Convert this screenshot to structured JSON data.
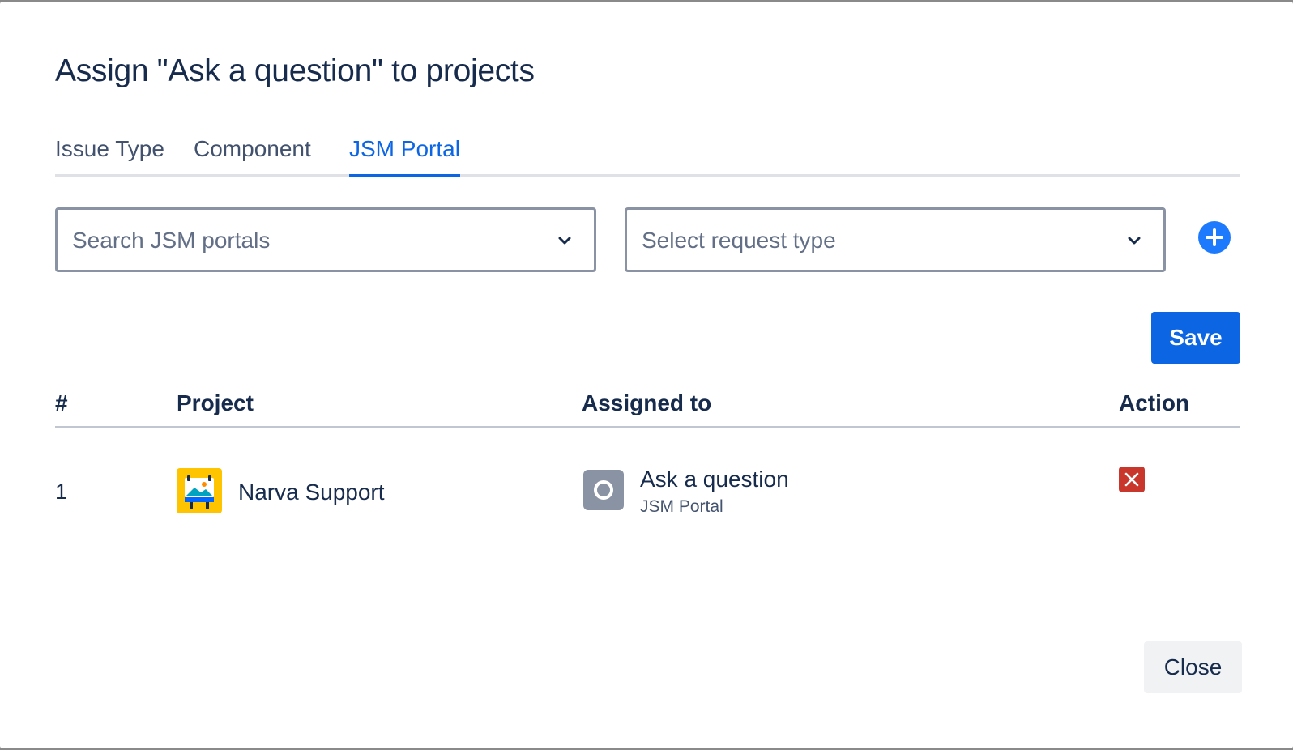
{
  "dialog": {
    "title": "Assign \"Ask a question\" to projects"
  },
  "tabs": [
    {
      "label": "Issue Type",
      "active": false
    },
    {
      "label": "Component",
      "active": false
    },
    {
      "label": "JSM Portal",
      "active": true
    }
  ],
  "filters": {
    "portal_placeholder": "Search JSM portals",
    "request_type_placeholder": "Select request type"
  },
  "actions": {
    "save_label": "Save",
    "close_label": "Close"
  },
  "table": {
    "headers": [
      "#",
      "Project",
      "Assigned to",
      "Action"
    ],
    "rows": [
      {
        "index": "1",
        "project": "Narva Support",
        "assigned_title": "Ask a question",
        "assigned_subtitle": "JSM Portal"
      }
    ]
  },
  "colors": {
    "accent": "#0c66e4",
    "add_button": "#1d7afc",
    "delete": "#c9372c",
    "project_avatar": "#ffc400"
  },
  "icons": {
    "add": "plus-circle-icon",
    "dropdown": "chevron-down-icon",
    "delete": "cross-icon",
    "project": "project-avatar-icon",
    "request_type": "request-type-icon"
  }
}
